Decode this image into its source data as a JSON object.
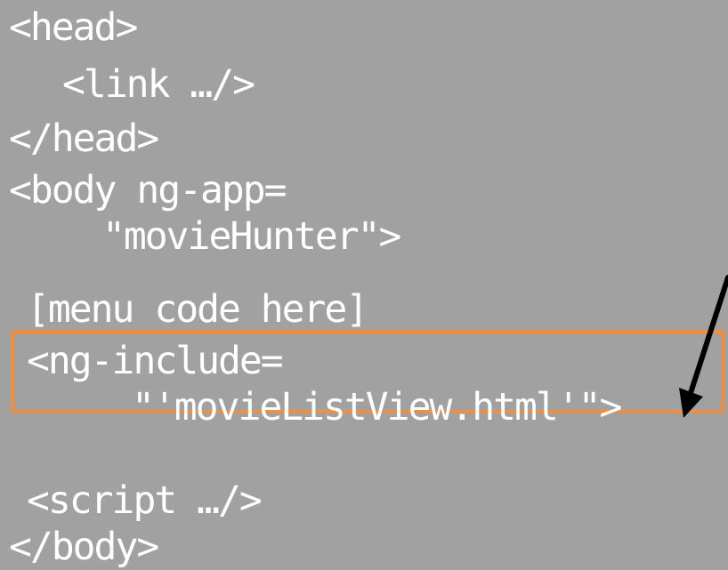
{
  "code_lines": {
    "head_open": "<head>",
    "link": "<link …/>",
    "head_close": "</head>",
    "body_open": "<body ng-app=",
    "app_name": "\"movieHunter\">",
    "menu_placeholder": "[menu code here]",
    "include_open": "<ng-include=",
    "include_value": "\"'movieListView.html'\">",
    "script": "<script …/>",
    "body_close": "</body>"
  },
  "colors": {
    "background": "#a1a1a1",
    "text": "#ffffff",
    "highlight_border": "#ef8f3f",
    "arrow": "#000000"
  }
}
